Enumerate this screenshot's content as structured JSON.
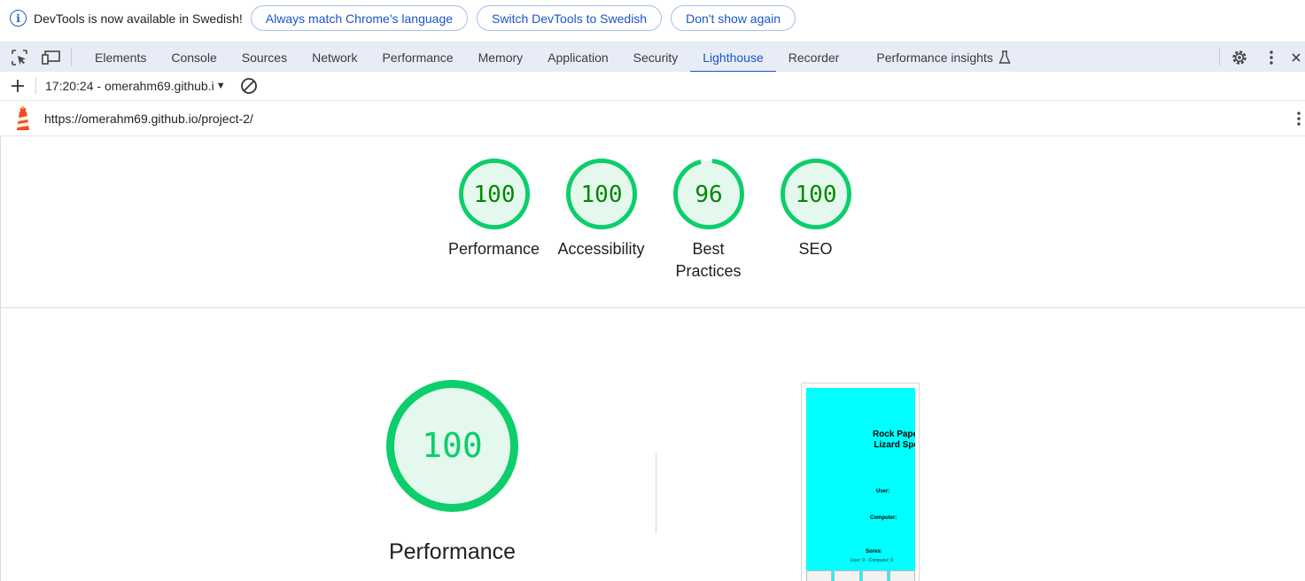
{
  "infobar": {
    "message": "DevTools is now available in Swedish!",
    "buttons": [
      "Always match Chrome's language",
      "Switch DevTools to Swedish",
      "Don't show again"
    ]
  },
  "tabs": [
    "Elements",
    "Console",
    "Sources",
    "Network",
    "Performance",
    "Memory",
    "Application",
    "Security",
    "Lighthouse",
    "Recorder",
    "Performance insights"
  ],
  "active_tab": "Lighthouse",
  "toolbar": {
    "report_select": "17:20:24 - omerahm69.github.i"
  },
  "url": "https://omerahm69.github.io/project-2/",
  "scores": [
    {
      "label": "Performance",
      "value": "100",
      "fraction": 1.0
    },
    {
      "label": "Accessibility",
      "value": "100",
      "fraction": 1.0
    },
    {
      "label": "Best Practices",
      "value": "96",
      "fraction": 0.96
    },
    {
      "label": "SEO",
      "value": "100",
      "fraction": 1.0
    }
  ],
  "main_score": {
    "label": "Performance",
    "value": "100",
    "fraction": 1.0
  },
  "thumbnail": {
    "title_line1": "Rock Paper Scisso",
    "title_line2": "Lizard Spock Gam",
    "user": "User:",
    "computer": "Computer:",
    "scores": "Sores:",
    "score_line": "User: 0 - Computer: 0"
  },
  "colors": {
    "pass": "#0cce6b",
    "pass_text": "#008800",
    "pass_bg": "#e5f8ee",
    "accent": "#1a56c6",
    "thumb_bg": "#00ffff"
  }
}
